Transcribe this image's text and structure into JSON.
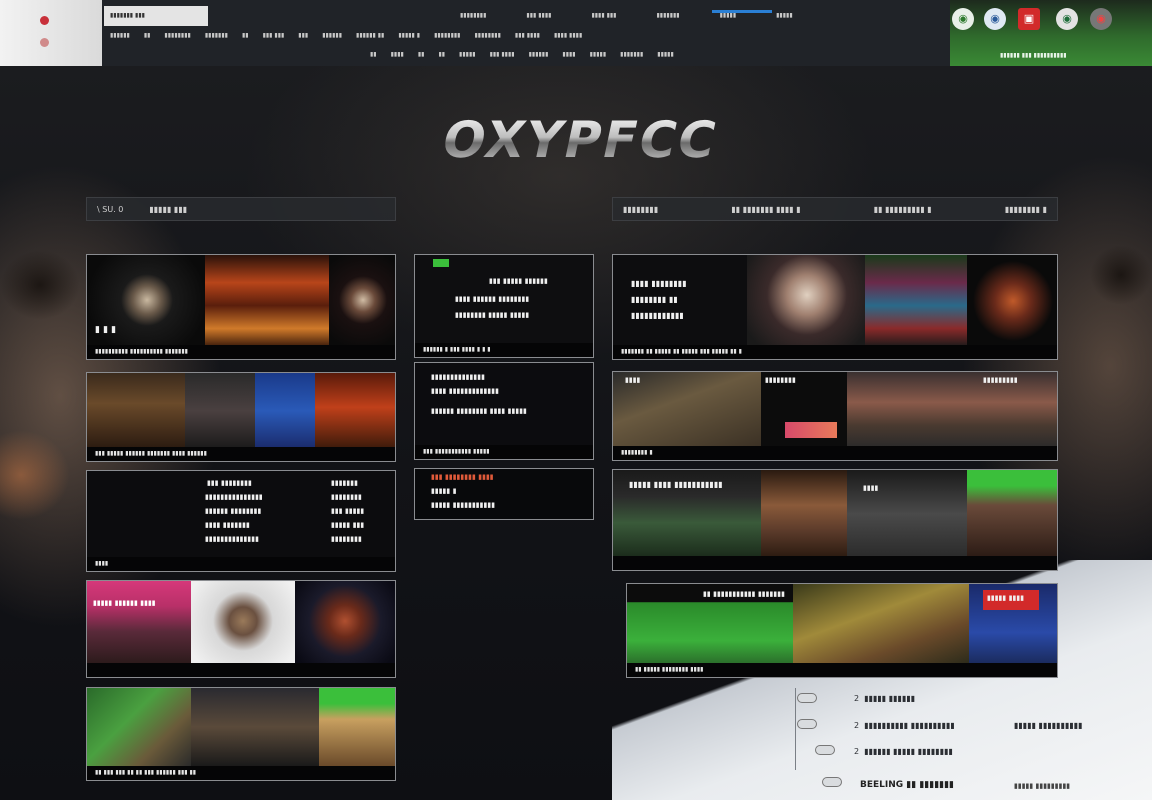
{
  "topbar": {
    "tab_label": "▮▮▮▮▮▮▮ ▮▮▮",
    "row1": [
      "▮▮▮▮▮▮▮▮",
      "▮▮▮ ▮▮▮▮",
      "▮▮▮▮ ▮▮▮",
      "▮▮▮▮▮▮▮",
      "▮▮▮▮▮",
      "▮▮▮▮▮"
    ],
    "row2": [
      "▮▮▮▮▮▮",
      "▮▮",
      "▮▮▮▮▮▮▮▮",
      "▮▮▮▮▮▮▮",
      "▮▮",
      "▮▮▮ ▮▮▮",
      "▮▮▮",
      "▮▮▮▮▮▮",
      "▮▮▮▮▮▮ ▮▮",
      "▮▮▮▮▮ ▮",
      "▮▮▮▮▮▮▮▮",
      "▮▮▮▮▮▮▮▮",
      "▮▮▮ ▮▮▮▮",
      "▮▮▮▮ ▮▮▮▮"
    ],
    "row3": [
      "▮▮",
      "▮▮▮▮",
      "▮▮",
      "▮▮",
      "▮▮▮▮▮",
      "▮▮▮ ▮▮▮▮",
      "▮▮▮▮▮▮",
      "▮▮▮▮",
      "▮▮▮▮▮",
      "▮▮▮▮▮▮▮",
      "▮▮▮▮▮"
    ],
    "right_text": "▮▮▮▮▮▮ ▮▮▮ ▮▮▮▮▮▮▮▮▮▮",
    "badges": [
      "◉",
      "◉",
      "▣",
      "◉",
      "◉"
    ]
  },
  "logo": "OXYPFCC",
  "left_header": [
    "\\ SU. 0",
    "▮▮▮▮▮ ▮▮▮"
  ],
  "right_header": [
    "▮▮▮▮▮▮▮▮",
    "▮▮ ▮▮▮▮▮▮▮ ▮▮▮▮ ▮",
    "▮▮ ▮▮▮▮▮▮▮▮▮ ▮",
    "▮▮▮▮▮▮▮▮ ▮"
  ],
  "tiles_left": [
    {
      "caption": "▮▮▮▮▮▮▮▮▮▮ ▮▮▮▮▮▮▮▮▮▮ ▮▮▮▮▮▮▮",
      "overlay": "▮ ▮ ▮"
    },
    {
      "caption": "▮▮▮ ▮▮▮▮▮ ▮▮▮▮▮▮ ▮▮▮▮▮▮▮ ▮▮▮▮ ▮▮▮▮▮▮"
    },
    {
      "lines_a": [
        "▮▮▮ ▮▮▮▮▮▮▮▮",
        "▮▮▮▮▮▮▮▮▮▮▮▮▮▮▮",
        "▮▮▮▮▮▮ ▮▮▮▮▮▮▮▮",
        "▮▮▮▮ ▮▮▮▮▮▮▮",
        "▮▮▮▮▮▮▮▮▮▮▮▮▮▮"
      ],
      "lines_b": [
        "▮▮▮▮▮▮▮",
        "▮▮▮▮▮▮▮▮",
        "▮▮▮ ▮▮▮▮▮",
        "▮▮▮▮▮ ▮▮▮",
        "▮▮▮▮▮▮▮▮"
      ],
      "caption": "▮▮▮▮"
    },
    {
      "banner": "▮▮▮▮▮ ▮▮▮▮▮▮ ▮▮▮▮",
      "caption": ""
    },
    {
      "caption": "▮▮ ▮▮▮ ▮▮▮ ▮▮ ▮▮ ▮▮▮ ▮▮▮▮▮▮ ▮▮▮ ▮▮"
    }
  ],
  "tiles_mid": [
    {
      "lines": [
        "▮▮▮ ▮▮▮▮▮ ▮▮▮▮▮▮",
        "▮▮▮▮ ▮▮▮▮▮▮ ▮▮▮▮▮▮▮▮",
        "▮▮▮▮▮▮▮▮ ▮▮▮▮▮ ▮▮▮▮▮"
      ],
      "caption": "▮▮▮▮▮▮ ▮ ▮▮▮ ▮▮▮▮ ▮ ▮ ▮"
    },
    {
      "lines": [
        "▮▮▮▮▮▮▮▮▮▮▮▮▮▮",
        "▮▮▮▮ ▮▮▮▮▮▮▮▮▮▮▮▮▮",
        "▮▮▮▮▮▮ ▮▮▮▮▮▮▮▮ ▮▮▮▮ ▮▮▮▮▮"
      ],
      "caption": "▮▮▮ ▮▮▮▮▮▮▮▮▮▮▮ ▮▮▮▮▮"
    },
    {
      "lines": [
        "▮▮▮ ▮▮▮▮▮▮▮▮ ▮▮▮▮",
        "▮▮▮▮▮ ▮",
        "▮▮▮▮▮ ▮▮▮▮▮▮▮▮▮▮▮"
      ]
    }
  ],
  "tiles_right": [
    {
      "lines": [
        "▮▮▮▮ ▮▮▮▮▮▮▮▮",
        "▮▮▮▮▮▮▮▮ ▮▮",
        "▮▮▮▮▮▮▮▮▮▮▮▮"
      ],
      "caption": "▮▮▮▮▮▮▮ ▮▮ ▮▮▮▮▮ ▮▮ ▮▮▮▮▮ ▮▮▮ ▮▮▮▮▮ ▮▮ ▮"
    },
    {
      "labels": [
        "▮▮▮▮",
        "▮▮▮▮▮▮▮▮",
        "▮▮▮▮▮▮▮▮▮"
      ],
      "caption": "▮▮▮▮▮▮▮▮ ▮"
    },
    {
      "title": "▮▮▮▮▮ ▮▮▮▮ ▮▮▮▮▮▮▮▮▮▮▮",
      "labels": [
        "▮▮▮▮"
      ],
      "caption": ""
    },
    {
      "title": "▮▮ ▮▮▮▮▮▮▮▮▮▮▮ ▮▮▮▮▮▮▮",
      "banner": "▮▮▮▮▮ ▮▮▮▮",
      "caption": "▮▮ ▮▮▮▮▮ ▮▮▮▮▮▮▮▮ ▮▮▮▮"
    }
  ],
  "info_list": [
    {
      "num": "2",
      "text": "▮▮▮▮▮ ▮▮▮▮▮▮"
    },
    {
      "num": "2",
      "text": "▮▮▮▮▮▮▮▮▮▮ ▮▮▮▮▮▮▮▮▮▮",
      "text2": "▮▮▮▮▮ ▮▮▮▮▮▮▮▮▮▮"
    },
    {
      "num": "2",
      "text": "▮▮▮▮▮▮ ▮▮▮▮▮ ▮▮▮▮▮▮▮▮"
    }
  ],
  "info_foot": "BEELING ▮▮ ▮▮▮▮▮▮▮",
  "info_foot2": "▮▮▮▮▮ ▮▮▮▮▮▮▮▮▮",
  "colors": {
    "accent": "#2a7fd4",
    "green": "#3bbf3b",
    "pink": "#d6387a",
    "red": "#d22a2a"
  }
}
